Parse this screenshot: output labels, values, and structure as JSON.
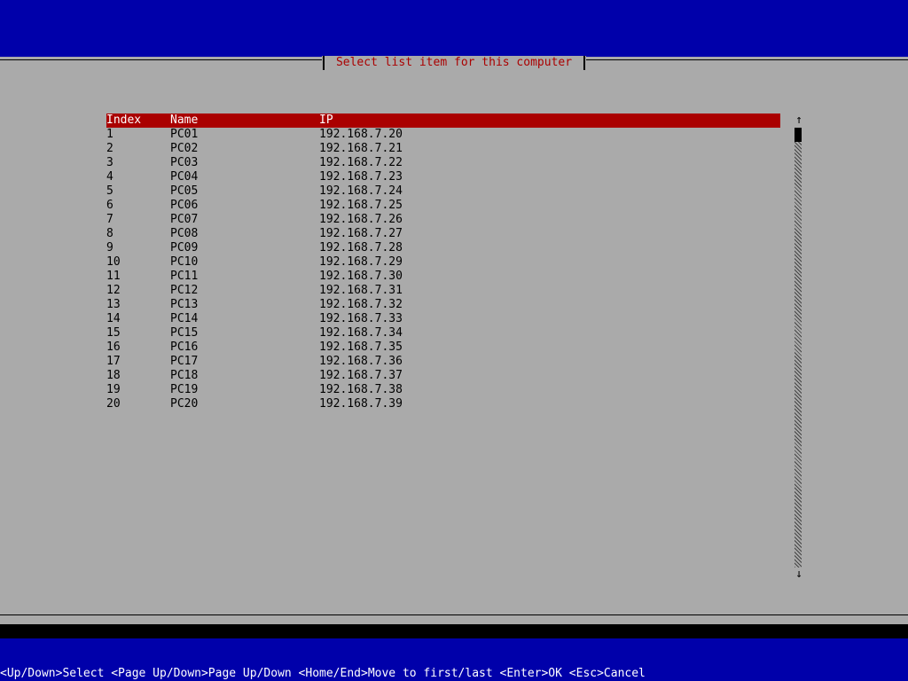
{
  "dialog": {
    "title": "Select list item for this computer"
  },
  "table": {
    "columns": [
      "Index",
      "Name",
      "IP"
    ],
    "rows": [
      [
        "1",
        "PC01",
        "192.168.7.20"
      ],
      [
        "2",
        "PC02",
        "192.168.7.21"
      ],
      [
        "3",
        "PC03",
        "192.168.7.22"
      ],
      [
        "4",
        "PC04",
        "192.168.7.23"
      ],
      [
        "5",
        "PC05",
        "192.168.7.24"
      ],
      [
        "6",
        "PC06",
        "192.168.7.25"
      ],
      [
        "7",
        "PC07",
        "192.168.7.26"
      ],
      [
        "8",
        "PC08",
        "192.168.7.27"
      ],
      [
        "9",
        "PC09",
        "192.168.7.28"
      ],
      [
        "10",
        "PC10",
        "192.168.7.29"
      ],
      [
        "11",
        "PC11",
        "192.168.7.30"
      ],
      [
        "12",
        "PC12",
        "192.168.7.31"
      ],
      [
        "13",
        "PC13",
        "192.168.7.32"
      ],
      [
        "14",
        "PC14",
        "192.168.7.33"
      ],
      [
        "15",
        "PC15",
        "192.168.7.34"
      ],
      [
        "16",
        "PC16",
        "192.168.7.35"
      ],
      [
        "17",
        "PC17",
        "192.168.7.36"
      ],
      [
        "18",
        "PC18",
        "192.168.7.37"
      ],
      [
        "19",
        "PC19",
        "192.168.7.38"
      ],
      [
        "20",
        "PC20",
        "192.168.7.39"
      ]
    ]
  },
  "scrollbar": {
    "up_arrow": "↑",
    "down_arrow": "↓"
  },
  "status_bar": {
    "text": "<Up/Down>Select <Page Up/Down>Page Up/Down <Home/End>Move to first/last <Enter>OK <Esc>Cancel"
  },
  "colors": {
    "background": "#0000aa",
    "panel": "#aaaaaa",
    "accent": "#aa0000",
    "text": "#000000",
    "status_text": "#ffffff"
  }
}
